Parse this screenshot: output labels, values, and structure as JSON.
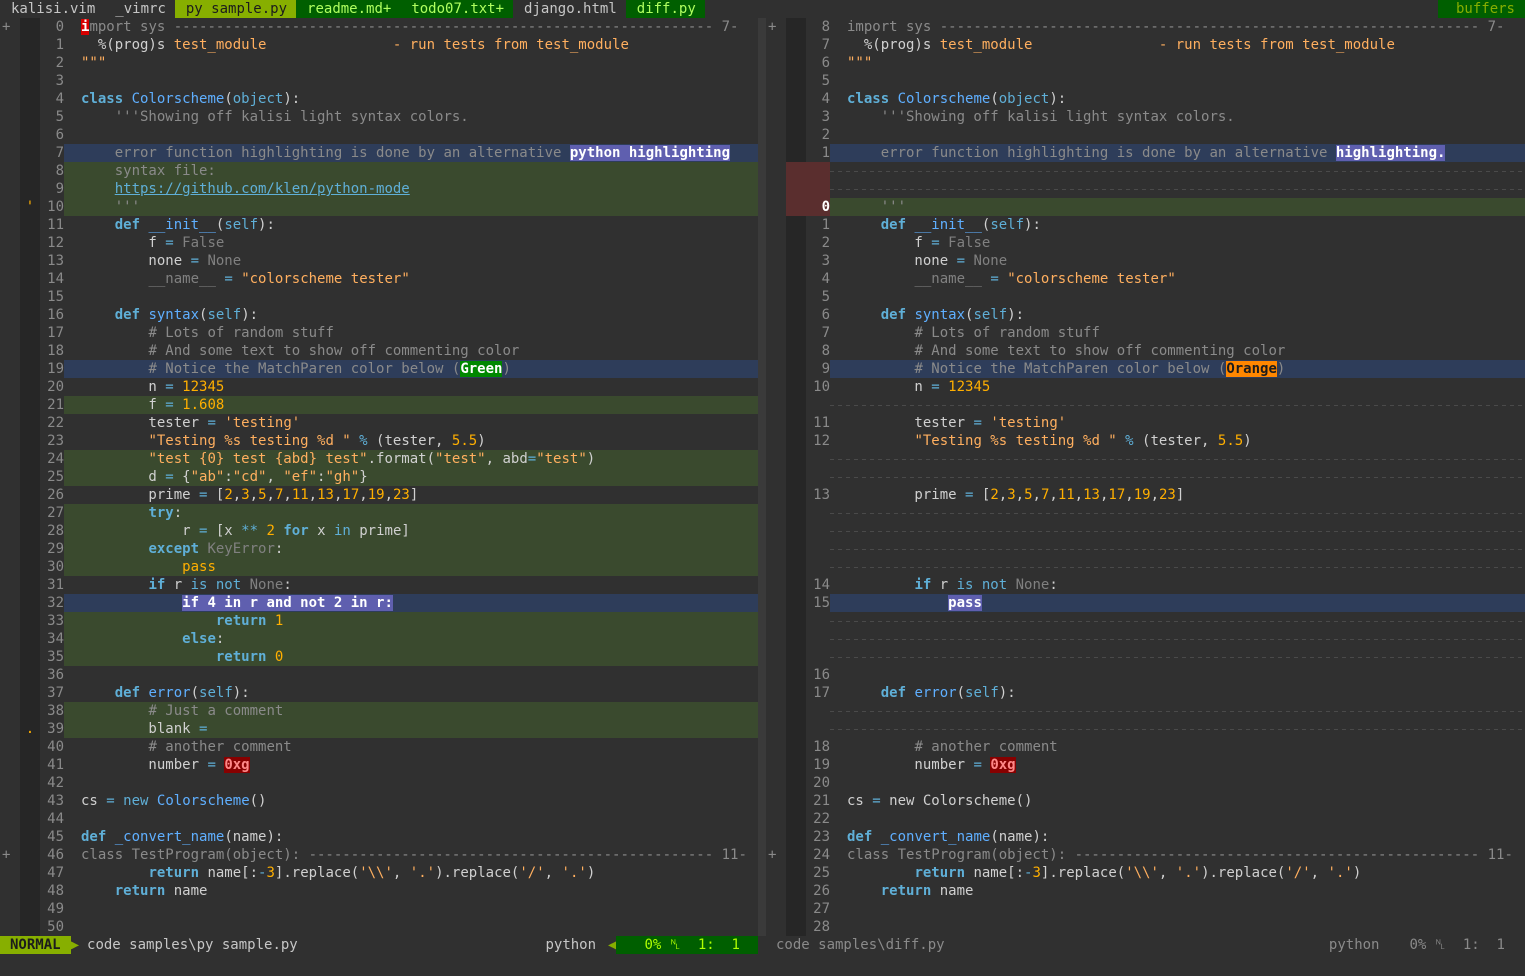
{
  "tabs": [
    {
      "label": "kalisi.vim",
      "state": "plain"
    },
    {
      "label": "_vimrc",
      "state": "plain"
    },
    {
      "label": "py sample.py",
      "state": "sel"
    },
    {
      "label": "readme.md+",
      "state": "mod"
    },
    {
      "label": "todo07.txt+",
      "state": "mod"
    },
    {
      "label": "django.html",
      "state": "plain"
    },
    {
      "label": "diff.py",
      "state": "mod"
    }
  ],
  "buffers_label": "buffers",
  "left_status": {
    "mode": "NORMAL",
    "file": "code samples\\py sample.py",
    "filetype": "python",
    "percent": "0%",
    "pos": "1:  1"
  },
  "right_status": {
    "file": "code samples\\diff.py",
    "filetype": "python",
    "percent": "0%",
    "pos": "1:  1"
  },
  "left_lines": [
    {
      "n": "0",
      "fold": "+",
      "sign": "",
      "bg": "fold",
      "html": "<span class='err' style='background:#d70000;color:#fff'>i</span>mport sys ---------------------------------------------------------------- 7-"
    },
    {
      "n": "1",
      "html": "  %(prog)s <span class='s'>test_module</span>               <span class='s'>- run tests from test_module</span>"
    },
    {
      "n": "2",
      "html": "<span class='s'>\"\"\"</span>"
    },
    {
      "n": "3",
      "html": ""
    },
    {
      "n": "4",
      "html": "<span class='k'>class</span> <span class='f'>Colorscheme</span>(<span class='o'>object</span>):"
    },
    {
      "n": "5",
      "html": "    <span class='c'>'''Showing off kalisi light syntax colors.</span>"
    },
    {
      "n": "6",
      "html": ""
    },
    {
      "n": "7",
      "bg": "change",
      "html": "    <span class='c'>error function highlighting is done by an alternative </span><span class='sel-hl'>python highlighting</span>"
    },
    {
      "n": "8",
      "bg": "add",
      "html": "    <span class='c'>syntax file:</span>"
    },
    {
      "n": "9",
      "bg": "add",
      "html": "    <span class='link'>https://github.com/klen/python-mode</span>"
    },
    {
      "n": "10",
      "sign": "'",
      "bg": "add",
      "html": "    <span class='c'>'''</span>"
    },
    {
      "n": "11",
      "html": "    <span class='k'>def</span> <span class='f'>__init__</span>(<span class='o'>self</span>):"
    },
    {
      "n": "12",
      "html": "        f <span class='o'>=</span> <span class='b'>False</span>"
    },
    {
      "n": "13",
      "html": "        none <span class='o'>=</span> <span class='b'>None</span>"
    },
    {
      "n": "14",
      "html": "        <span class='b'>__name__</span> <span class='o'>=</span> <span class='s'>\"colorscheme tester\"</span>"
    },
    {
      "n": "15",
      "html": ""
    },
    {
      "n": "16",
      "html": "    <span class='k'>def</span> <span class='f'>syntax</span>(<span class='o'>self</span>):"
    },
    {
      "n": "17",
      "html": "        <span class='c'># Lots of random stuff</span>"
    },
    {
      "n": "18",
      "html": "        <span class='c'># And some text to show off commenting color</span>"
    },
    {
      "n": "19",
      "bg": "change",
      "html": "        <span class='c'># Notice the MatchParen color below (</span><span class='paren-g'>Green</span><span class='c'>)</span>"
    },
    {
      "n": "20",
      "html": "        n <span class='o'>=</span> <span class='n'>12345</span>"
    },
    {
      "n": "21",
      "bg": "add",
      "html": "        f <span class='o'>=</span> <span class='n'>1.608</span>"
    },
    {
      "n": "22",
      "html": "        tester <span class='o'>=</span> <span class='s'>'testing'</span>"
    },
    {
      "n": "23",
      "html": "        <span class='s'>\"Testing %s testing %d \"</span> <span class='o'>%</span> (tester, <span class='n'>5.5</span>)"
    },
    {
      "n": "24",
      "bg": "add",
      "html": "        <span class='s'>\"test {0} test {abd} test\"</span>.format(<span class='s'>\"test\"</span>, abd<span class='o'>=</span><span class='s'>\"test\"</span>)"
    },
    {
      "n": "25",
      "bg": "add",
      "html": "        d <span class='o'>=</span> {<span class='s'>\"ab\"</span>:<span class='s'>\"cd\"</span>, <span class='s'>\"ef\"</span>:<span class='s'>\"gh\"</span>}"
    },
    {
      "n": "26",
      "html": "        prime <span class='o'>=</span> [<span class='n'>2</span>,<span class='n'>3</span>,<span class='n'>5</span>,<span class='n'>7</span>,<span class='n'>11</span>,<span class='n'>13</span>,<span class='n'>17</span>,<span class='n'>19</span>,<span class='n'>23</span>]"
    },
    {
      "n": "27",
      "bg": "add",
      "html": "        <span class='k'>try</span>:"
    },
    {
      "n": "28",
      "bg": "add",
      "html": "            r <span class='o'>=</span> [x <span class='o'>**</span> <span class='n'>2</span> <span class='k'>for</span> x <span class='o'>in</span> prime]"
    },
    {
      "n": "29",
      "bg": "add",
      "html": "        <span class='k'>except</span> <span class='b'>KeyError</span>:"
    },
    {
      "n": "30",
      "bg": "add",
      "html": "            <span class='n'>pass</span>"
    },
    {
      "n": "31",
      "html": "        <span class='k'>if</span> r <span class='o'>is not</span> <span class='b'>None</span>:"
    },
    {
      "n": "32",
      "bg": "change",
      "html": "            <span class='sel-hl'>if 4 in r and not 2 in r:</span>"
    },
    {
      "n": "33",
      "bg": "add",
      "html": "                <span class='k'>return</span> <span class='n'>1</span>"
    },
    {
      "n": "34",
      "bg": "add",
      "html": "            <span class='k'>else</span>:"
    },
    {
      "n": "35",
      "bg": "add",
      "html": "                <span class='k'>return</span> <span class='n'>0</span>"
    },
    {
      "n": "36",
      "html": ""
    },
    {
      "n": "37",
      "html": "    <span class='k'>def</span> <span class='f'>error</span>(<span class='o'>self</span>):"
    },
    {
      "n": "38",
      "bg": "add",
      "html": "        <span class='c'># Just a comment</span>"
    },
    {
      "n": "39",
      "sign": ".",
      "bg": "add",
      "html": "        blank <span class='o'>=</span>"
    },
    {
      "n": "40",
      "html": "        <span class='c'># another comment</span>"
    },
    {
      "n": "41",
      "html": "        number <span class='o'>=</span> <span class='err'>0xg</span>"
    },
    {
      "n": "42",
      "html": ""
    },
    {
      "n": "43",
      "html": "cs <span class='o'>=</span> <span class='k' style='font-weight:normal'>new</span> <span class='f'>Colorscheme</span>()"
    },
    {
      "n": "44",
      "html": ""
    },
    {
      "n": "45",
      "html": "<span class='k'>def</span> <span class='f'>_convert_name</span>(name):"
    },
    {
      "n": "46",
      "fold": "+",
      "bg": "fold",
      "html": "class TestProgram(object): ------------------------------------------------ 11-"
    },
    {
      "n": "47",
      "html": "        <span class='k'>return</span> name[:<span class='o'>-</span><span class='n'>3</span>].replace(<span class='s'>'\\\\'</span>, <span class='s'>'.'</span>).replace(<span class='s'>'/'</span>, <span class='s'>'.'</span>)"
    },
    {
      "n": "48",
      "html": "    <span class='k'>return</span> name"
    },
    {
      "n": "49",
      "html": ""
    },
    {
      "n": "50",
      "html": ""
    }
  ],
  "right_lines": [
    {
      "n": "8",
      "fold": "+",
      "bg": "fold",
      "html": "import sys ---------------------------------------------------------------- 7-"
    },
    {
      "n": "7",
      "html": "  %(prog)s <span class='s'>test_module</span>               <span class='s'>- run tests from test_module</span>"
    },
    {
      "n": "6",
      "html": "<span class='s'>\"\"\"</span>"
    },
    {
      "n": "5",
      "html": ""
    },
    {
      "n": "4",
      "html": "<span class='k'>class</span> <span class='f'>Colorscheme</span>(<span class='o'>object</span>):"
    },
    {
      "n": "3",
      "html": "    <span class='c'>'''Showing off kalisi light syntax colors.</span>"
    },
    {
      "n": "2",
      "html": ""
    },
    {
      "n": "1",
      "bg": "change",
      "html": "    <span class='c'>error function highlighting is done by an alternative </span><span class='sel-hl'>highlighting.</span>"
    },
    {
      "n": "",
      "bg": "filler",
      "del": true,
      "html": ""
    },
    {
      "n": "",
      "bg": "filler",
      "del": true,
      "html": ""
    },
    {
      "n": "0",
      "bg": "add",
      "del": true,
      "bold": true,
      "html": "    <span class='c'>'''</span>"
    },
    {
      "n": "1",
      "html": "    <span class='k'>def</span> <span class='f'>__init__</span>(<span class='o'>self</span>):"
    },
    {
      "n": "2",
      "html": "        f <span class='o'>=</span> <span class='b'>False</span>"
    },
    {
      "n": "3",
      "html": "        none <span class='o'>=</span> <span class='b'>None</span>"
    },
    {
      "n": "4",
      "html": "        <span class='b'>__name__</span> <span class='o'>=</span> <span class='s'>\"colorscheme tester\"</span>"
    },
    {
      "n": "5",
      "html": ""
    },
    {
      "n": "6",
      "html": "    <span class='k'>def</span> <span class='f'>syntax</span>(<span class='o'>self</span>):"
    },
    {
      "n": "7",
      "html": "        <span class='c'># Lots of random stuff</span>"
    },
    {
      "n": "8",
      "html": "        <span class='c'># And some text to show off commenting color</span>"
    },
    {
      "n": "9",
      "bg": "change",
      "html": "        <span class='c'># Notice the MatchParen color below (</span><span class='paren-o'>Orange</span><span class='c'>)</span>"
    },
    {
      "n": "10",
      "html": "        n <span class='o'>=</span> <span class='n'>12345</span>"
    },
    {
      "n": "",
      "bg": "filler",
      "html": ""
    },
    {
      "n": "11",
      "html": "        tester <span class='o'>=</span> <span class='s'>'testing'</span>"
    },
    {
      "n": "12",
      "html": "        <span class='s'>\"Testing %s testing %d \"</span> <span class='o'>%</span> (tester, <span class='n'>5.5</span>)"
    },
    {
      "n": "",
      "bg": "filler",
      "html": ""
    },
    {
      "n": "",
      "bg": "filler",
      "html": ""
    },
    {
      "n": "13",
      "html": "        prime <span class='o'>=</span> [<span class='n'>2</span>,<span class='n'>3</span>,<span class='n'>5</span>,<span class='n'>7</span>,<span class='n'>11</span>,<span class='n'>13</span>,<span class='n'>17</span>,<span class='n'>19</span>,<span class='n'>23</span>]"
    },
    {
      "n": "",
      "bg": "filler",
      "html": ""
    },
    {
      "n": "",
      "bg": "filler",
      "html": ""
    },
    {
      "n": "",
      "bg": "filler",
      "html": ""
    },
    {
      "n": "",
      "bg": "filler",
      "html": ""
    },
    {
      "n": "14",
      "html": "        <span class='k'>if</span> r <span class='o'>is not</span> <span class='b'>None</span>:"
    },
    {
      "n": "15",
      "bg": "change",
      "html": "            <span class='sel-hl'>pass</span>"
    },
    {
      "n": "",
      "bg": "filler",
      "html": ""
    },
    {
      "n": "",
      "bg": "filler",
      "html": ""
    },
    {
      "n": "",
      "bg": "filler",
      "html": ""
    },
    {
      "n": "16",
      "html": ""
    },
    {
      "n": "17",
      "html": "    <span class='k'>def</span> <span class='f'>error</span>(<span class='o'>self</span>):"
    },
    {
      "n": "",
      "bg": "filler",
      "html": ""
    },
    {
      "n": "",
      "bg": "filler",
      "html": ""
    },
    {
      "n": "18",
      "html": "        <span class='c'># another comment</span>"
    },
    {
      "n": "19",
      "html": "        number <span class='o'>=</span> <span class='err'>0xg</span>"
    },
    {
      "n": "20",
      "html": ""
    },
    {
      "n": "21",
      "html": "cs <span class='o'>=</span> new Colorscheme()"
    },
    {
      "n": "22",
      "html": ""
    },
    {
      "n": "23",
      "html": "<span class='k'>def</span> <span class='f'>_convert_name</span>(name):"
    },
    {
      "n": "24",
      "fold": "+",
      "bg": "fold",
      "html": "class TestProgram(object): ------------------------------------------------ 11-"
    },
    {
      "n": "25",
      "html": "        <span class='k'>return</span> name[:<span class='o'>-</span><span class='n'>3</span>].replace(<span class='s'>'\\\\'</span>, <span class='s'>'.'</span>).replace(<span class='s'>'/'</span>, <span class='s'>'.'</span>)"
    },
    {
      "n": "26",
      "html": "    <span class='k'>return</span> name"
    },
    {
      "n": "27",
      "html": ""
    },
    {
      "n": "28",
      "html": ""
    }
  ]
}
